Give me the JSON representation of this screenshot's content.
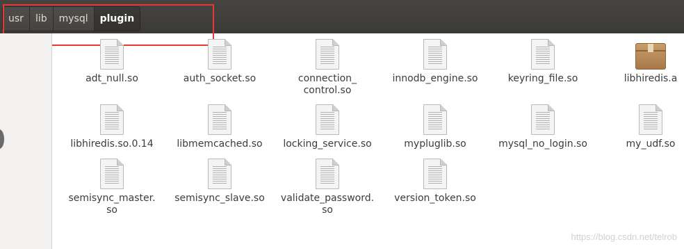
{
  "breadcrumb": [
    "usr",
    "lib",
    "mysql",
    "plugin"
  ],
  "files": {
    "r0": [
      "adt_null.so",
      "auth_socket.so",
      "connection_\ncontrol.so",
      "innodb_engine.so",
      "keyring_file.so",
      "libhiredis.a"
    ],
    "r1": [
      "libhiredis.so.0.14",
      "libmemcached.so",
      "locking_service.so",
      "mypluglib.so",
      "mysql_no_login.so",
      "my_udf.so"
    ],
    "r2": [
      "semisync_master.\nso",
      "semisync_slave.so",
      "validate_password.\nso",
      "version_token.so"
    ]
  },
  "watermark": "https://blog.csdn.net/telrob"
}
